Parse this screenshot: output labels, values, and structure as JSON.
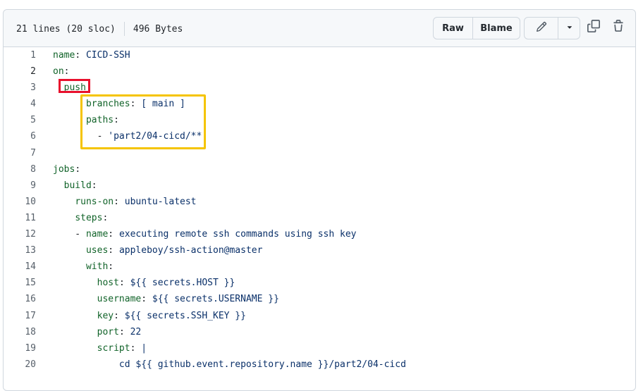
{
  "header": {
    "lines_info": "21 lines (20 sloc)",
    "size": "496 Bytes",
    "raw_label": "Raw",
    "blame_label": "Blame"
  },
  "icons": {
    "edit": "pencil-icon",
    "dropdown": "triangle-down-icon",
    "copy": "copy-icon",
    "delete": "trash-icon"
  },
  "colors": {
    "highlight_red": "#e8112d",
    "highlight_yellow": "#f5c400",
    "yaml_key": "#116329",
    "yaml_string": "#0a3069"
  },
  "code": {
    "line_numbers": [
      "1",
      "2",
      "3",
      "4",
      "5",
      "6",
      "7",
      "8",
      "9",
      "10",
      "11",
      "12",
      "13",
      "14",
      "15",
      "16",
      "17",
      "18",
      "19",
      "20"
    ],
    "l1": {
      "key": "name",
      "val": "CICD-SSH"
    },
    "l2": {
      "key": "on"
    },
    "l3": {
      "key": "push"
    },
    "l4": {
      "key": "branches",
      "val": "[ main ]"
    },
    "l5": {
      "key": "paths"
    },
    "l6": {
      "val": "'part2/04-cicd/**'"
    },
    "l8": {
      "key": "jobs"
    },
    "l9": {
      "key": "build"
    },
    "l10": {
      "key": "runs-on",
      "val": "ubuntu-latest"
    },
    "l11": {
      "key": "steps"
    },
    "l12": {
      "key": "name",
      "val": "executing remote ssh commands using ssh key"
    },
    "l13": {
      "key": "uses",
      "val": "appleboy/ssh-action@master"
    },
    "l14": {
      "key": "with"
    },
    "l15": {
      "key": "host",
      "val": "${{ secrets.HOST }}"
    },
    "l16": {
      "key": "username",
      "val": "${{ secrets.USERNAME }}"
    },
    "l17": {
      "key": "key",
      "val": "${{ secrets.SSH_KEY }}"
    },
    "l18": {
      "key": "port",
      "val": "22"
    },
    "l19": {
      "key": "script",
      "val": "|"
    },
    "l20": {
      "val": "cd ${{ github.event.repository.name }}/part2/04-cicd"
    }
  }
}
